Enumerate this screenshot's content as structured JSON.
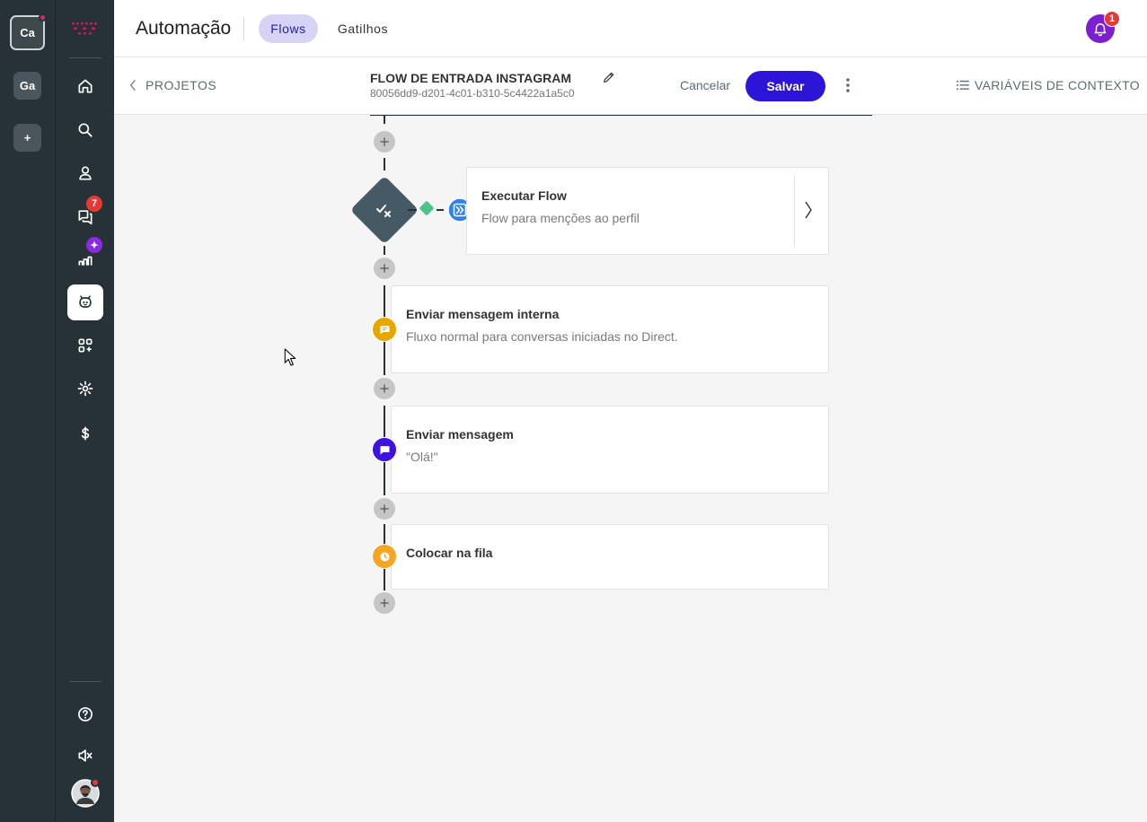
{
  "workspaces": [
    {
      "label": "Ca",
      "active": true,
      "has_dot": true
    },
    {
      "label": "Ga",
      "active": false,
      "has_dot": false
    },
    {
      "label": "+",
      "active": false,
      "has_dot": false
    }
  ],
  "nav": {
    "items": [
      {
        "icon": "home-icon"
      },
      {
        "icon": "search-icon"
      },
      {
        "icon": "contacts-icon"
      },
      {
        "icon": "chat-icon",
        "badge": "7"
      },
      {
        "icon": "analytics-icon",
        "badge": "✦"
      },
      {
        "icon": "bot-icon",
        "active": true
      },
      {
        "icon": "apps-icon"
      },
      {
        "icon": "gear-icon"
      },
      {
        "icon": "dollar-icon"
      }
    ],
    "bottom": [
      {
        "icon": "help-icon"
      },
      {
        "icon": "volume-mute-icon"
      },
      {
        "icon": "avatar"
      }
    ]
  },
  "header": {
    "app_title": "Automação",
    "tabs": [
      {
        "label": "Flows",
        "active": true
      },
      {
        "label": "Gatilhos",
        "active": false
      }
    ],
    "notifications_count": "1"
  },
  "subbar": {
    "back_label": "PROJETOS",
    "flow_title": "FLOW DE ENTRADA INSTAGRAM",
    "flow_id": "80056dd9-d201-4c01-b310-5c4422a1a5c0",
    "cancel_label": "Cancelar",
    "save_label": "Salvar",
    "vars_label": "VARIÁVEIS DE CONTEXTO"
  },
  "flow": {
    "steps": [
      {
        "title": "Executar Flow",
        "subtitle": "Flow para menções ao perfil",
        "icon": "execute-flow-icon",
        "color": "#2f80ed"
      },
      {
        "title": "Enviar mensagem interna",
        "subtitle": "Fluxo normal para conversas iniciadas no Direct.",
        "icon": "internal-message-icon",
        "color": "#e6a800"
      },
      {
        "title": "Enviar mensagem",
        "subtitle": "\"Olá!\"",
        "icon": "message-icon",
        "color": "#3f12e0"
      },
      {
        "title": "Colocar na fila",
        "subtitle": "",
        "icon": "clock-icon",
        "color": "#f5a623"
      }
    ]
  },
  "colors": {
    "sidebar": "#263238",
    "primary": "#2d14d9",
    "accent_purple": "#7c1fd0",
    "badge_red": "#e53935"
  }
}
